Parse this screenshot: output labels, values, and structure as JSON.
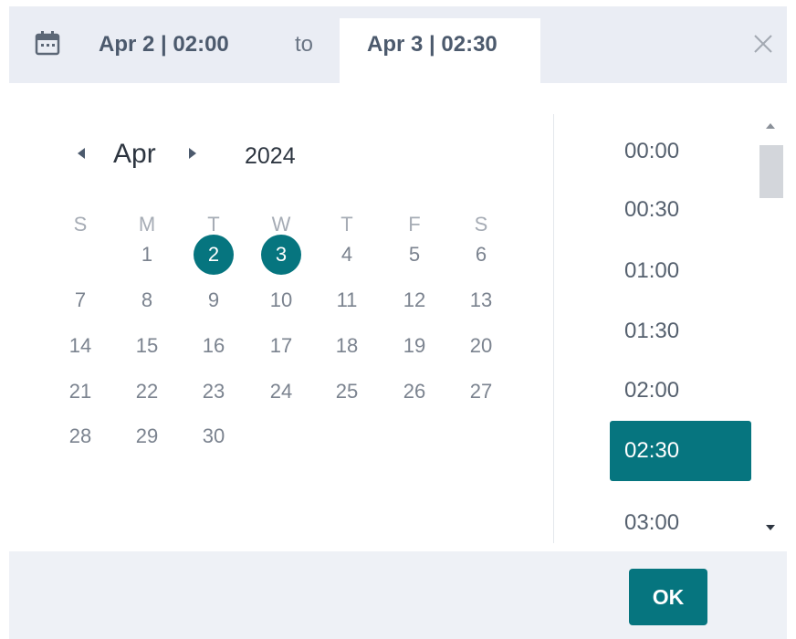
{
  "header": {
    "start_label": "Apr 2 | 02:00",
    "to_label": "to",
    "end_label": "Apr 3 | 02:30",
    "icons": {
      "calendar": "calendar-icon",
      "close": "close-icon"
    }
  },
  "calendar": {
    "month": "Apr",
    "year": "2024",
    "weekdays": [
      "S",
      "M",
      "T",
      "W",
      "T",
      "F",
      "S"
    ],
    "days": [
      "1",
      "2",
      "3",
      "4",
      "5",
      "6",
      "7",
      "8",
      "9",
      "10",
      "11",
      "12",
      "13",
      "14",
      "15",
      "16",
      "17",
      "18",
      "19",
      "20",
      "21",
      "22",
      "23",
      "24",
      "25",
      "26",
      "27",
      "28",
      "29",
      "30"
    ],
    "first_weekday_index": 1,
    "selected_days": [
      "2",
      "3"
    ],
    "icons": {
      "prev": "caret-left-icon",
      "next": "caret-right-icon"
    }
  },
  "times": {
    "items": [
      "00:00",
      "00:30",
      "01:00",
      "01:30",
      "02:00",
      "02:30",
      "03:00"
    ],
    "selected": "02:30"
  },
  "footer": {
    "ok_label": "OK"
  },
  "colors": {
    "accent": "#06757f",
    "header_bg": "#eaedf4",
    "footer_bg": "#eef1f6",
    "day_text": "#7b838f",
    "weekday_text": "#a6acb5"
  }
}
